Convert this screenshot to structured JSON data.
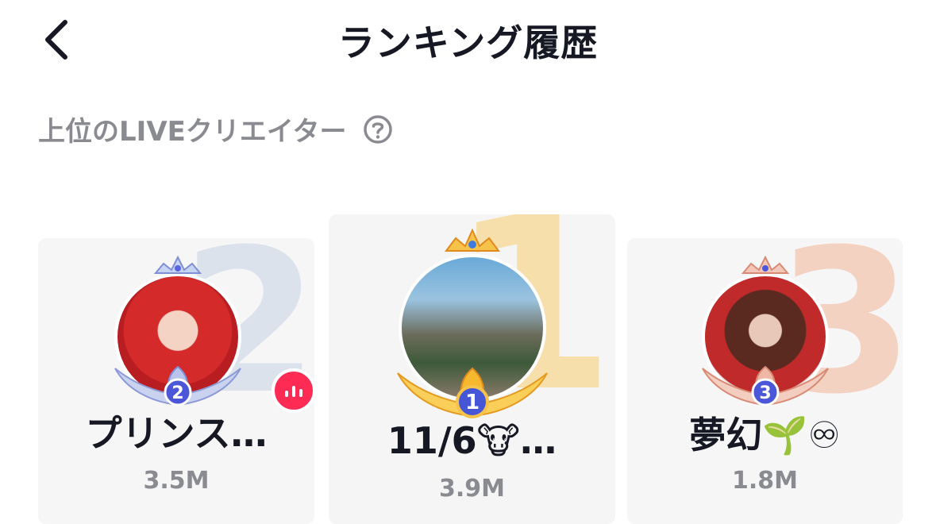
{
  "header": {
    "title": "ランキング履歴",
    "back_icon": "chevron-left-icon"
  },
  "section": {
    "label": "上位のLIVEクリエイター",
    "help_icon": "question-circle-icon"
  },
  "podium": [
    {
      "rank": "2",
      "name": "プリンス…",
      "score": "3.5M",
      "accent": "#5a63e0",
      "badge_icon": "live-audio-icon"
    },
    {
      "rank": "1",
      "name": "11/6🐮…",
      "score": "3.9M",
      "accent": "#f2b320"
    },
    {
      "rank": "3",
      "name": "夢幻🌱♾",
      "score": "1.8M",
      "accent": "#e88a78"
    }
  ]
}
